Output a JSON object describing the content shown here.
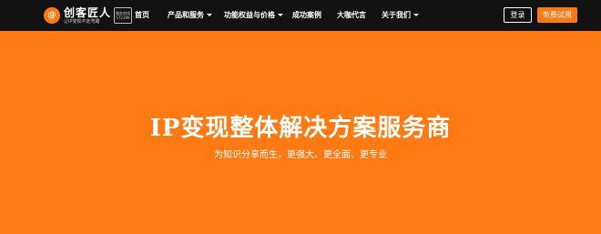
{
  "brand": {
    "logo_mark": "@",
    "name": "创客匠人",
    "tagline": "让IP变现不走弯路",
    "badge_line1": "服务热线",
    "badge_line2": "ST2399"
  },
  "nav": {
    "items": [
      {
        "label": "首页",
        "has_dropdown": false
      },
      {
        "label": "产品和服务",
        "has_dropdown": true
      },
      {
        "label": "功能权益与价格",
        "has_dropdown": true
      },
      {
        "label": "成功案例",
        "has_dropdown": false
      },
      {
        "label": "大咖代言",
        "has_dropdown": false
      },
      {
        "label": "关于我们",
        "has_dropdown": true
      }
    ],
    "login_label": "登录",
    "trial_label": "免费试用"
  },
  "hero": {
    "title": "IP变现整体解决方案服务商",
    "subtitle": "为知识分享而生，更强大、更全面、更专业"
  },
  "colors": {
    "accent": "#ff7a12",
    "nav_bg": "#121212",
    "text": "#ffffff"
  }
}
